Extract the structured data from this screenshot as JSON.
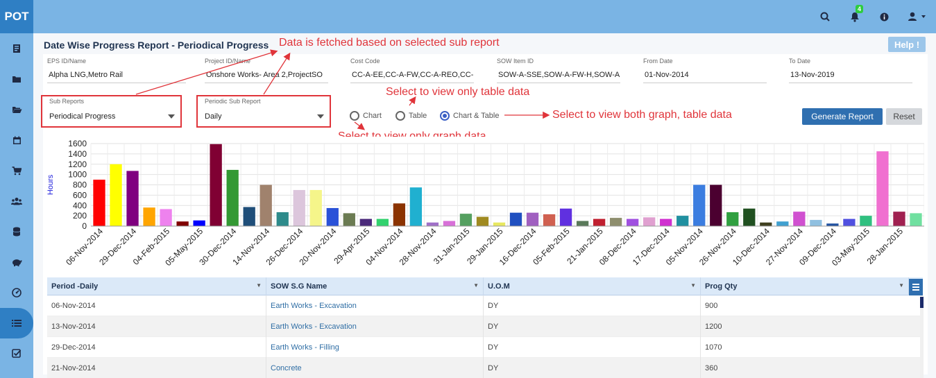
{
  "app": {
    "logo": "POT",
    "notification_count": "4"
  },
  "page": {
    "title": "Date Wise Progress Report - Periodical Progress",
    "help_label": "Help !"
  },
  "filters": [
    {
      "label": "EPS ID/Name",
      "value": "Alpha LNG,Metro Rail"
    },
    {
      "label": "Project ID/Name",
      "value": "Onshore  Works- Area 2,ProjectSO"
    },
    {
      "label": "Cost Code",
      "value": "CC-A-EE,CC-A-FW,CC-A-REO,CC-"
    },
    {
      "label": "SOW Item ID",
      "value": "SOW-A-SSE,SOW-A-FW-H,SOW-A"
    },
    {
      "label": "From Date",
      "value": "01-Nov-2014"
    },
    {
      "label": "To Date",
      "value": "13-Nov-2019"
    }
  ],
  "sub_reports": {
    "label": "Sub Reports",
    "value": "Periodical Progress"
  },
  "periodic_sub_report": {
    "label": "Periodic Sub Report",
    "value": "Daily"
  },
  "view_options": [
    {
      "label": "Chart",
      "selected": false
    },
    {
      "label": "Table",
      "selected": false
    },
    {
      "label": "Chart & Table",
      "selected": true
    }
  ],
  "buttons": {
    "generate": "Generate Report",
    "reset": "Reset"
  },
  "annotations": {
    "fetched": "Data is fetched based on selected sub report",
    "table_only": "Select to view only table data",
    "both": "Select to view both graph, table data",
    "graph_only": "Select to view only graph data"
  },
  "chart_data": {
    "type": "bar",
    "ylabel": "Hours",
    "xlabel": "",
    "ylim": [
      0,
      1600
    ],
    "yticks": [
      0,
      200,
      400,
      600,
      800,
      1000,
      1200,
      1400,
      1600
    ],
    "grid": true,
    "tick_labels": [
      "06-Nov-2014",
      "29-Dec-2014",
      "04-Feb-2015",
      "05-May-2015",
      "30-Dec-2014",
      "14-Nov-2014",
      "26-Dec-2014",
      "20-Nov-2014",
      "29-Apr-2015",
      "04-Nov-2014",
      "28-Nov-2014",
      "31-Jan-2015",
      "29-Jan-2015",
      "16-Dec-2014",
      "05-Feb-2015",
      "21-Jan-2015",
      "08-Dec-2014",
      "17-Dec-2014",
      "05-Nov-2014",
      "26-Nov-2014",
      "10-Dec-2014",
      "27-Nov-2014",
      "09-Dec-2014",
      "03-May-2015",
      "28-Jan-2015"
    ],
    "values": [
      900,
      1200,
      1070,
      360,
      330,
      90,
      110,
      1590,
      1090,
      370,
      800,
      270,
      700,
      700,
      350,
      250,
      140,
      140,
      440,
      750,
      70,
      100,
      240,
      180,
      70,
      260,
      260,
      230,
      340,
      100,
      140,
      160,
      140,
      170,
      140,
      200,
      800,
      800,
      270,
      340,
      70,
      90,
      280,
      120,
      50,
      140,
      200,
      1450,
      280,
      250
    ],
    "colors": [
      "#ff0000",
      "#ffff00",
      "#800080",
      "#ffa500",
      "#ee82ee",
      "#800000",
      "#0000ff",
      "#800033",
      "#339933",
      "#1f4e79",
      "#a0826d",
      "#2e8b8b",
      "#dcc6dc",
      "#f5f58a",
      "#2a52d8",
      "#6b7b52",
      "#4b2a7a",
      "#32d26e",
      "#8b3300",
      "#20b0d0",
      "#a070c8",
      "#d870d8",
      "#55a060",
      "#a08a20",
      "#e8e860",
      "#2050c0",
      "#a060c0",
      "#d06050",
      "#6030e0",
      "#5a7a5a",
      "#c02030",
      "#8e8e6e",
      "#a050e0",
      "#e0a0d0",
      "#d030d0",
      "#2090a0",
      "#3b7de0",
      "#4b0030",
      "#30a040",
      "#205020",
      "#404020",
      "#40a0d0",
      "#d050d0",
      "#90c0e0",
      "#2050a0",
      "#5050e0",
      "#30c080",
      "#f070d0",
      "#a02050",
      "#70e0a0"
    ]
  },
  "table": {
    "columns": [
      "Period -Daily",
      "SOW S.G Name",
      "U.O.M",
      "Prog Qty"
    ],
    "rows": [
      [
        "06-Nov-2014",
        "Earth Works - Excavation",
        "DY",
        "900"
      ],
      [
        "13-Nov-2014",
        "Earth Works - Excavation",
        "DY",
        "1200"
      ],
      [
        "29-Dec-2014",
        "Earth Works - Filling",
        "DY",
        "1070"
      ],
      [
        "21-Nov-2014",
        "Concrete",
        "DY",
        "360"
      ]
    ]
  }
}
